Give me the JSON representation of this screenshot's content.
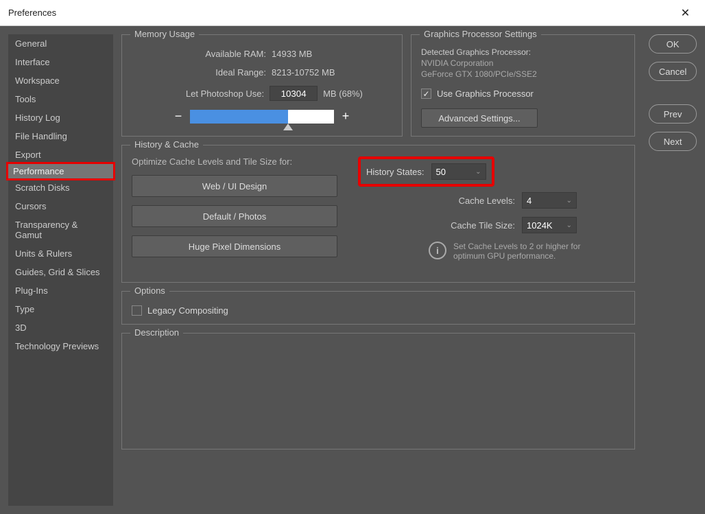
{
  "window": {
    "title": "Preferences"
  },
  "sidebar": {
    "items": [
      {
        "label": "General"
      },
      {
        "label": "Interface"
      },
      {
        "label": "Workspace"
      },
      {
        "label": "Tools"
      },
      {
        "label": "History Log"
      },
      {
        "label": "File Handling"
      },
      {
        "label": "Export"
      },
      {
        "label": "Performance",
        "selected": true
      },
      {
        "label": "Scratch Disks"
      },
      {
        "label": "Cursors"
      },
      {
        "label": "Transparency & Gamut"
      },
      {
        "label": "Units & Rulers"
      },
      {
        "label": "Guides, Grid & Slices"
      },
      {
        "label": "Plug-Ins"
      },
      {
        "label": "Type"
      },
      {
        "label": "3D"
      },
      {
        "label": "Technology Previews"
      }
    ]
  },
  "memory": {
    "title": "Memory Usage",
    "available_label": "Available RAM:",
    "available_value": "14933 MB",
    "ideal_label": "Ideal Range:",
    "ideal_value": "8213-10752 MB",
    "use_label": "Let Photoshop Use:",
    "use_value": "10304",
    "use_suffix": "MB (68%)"
  },
  "gpu": {
    "title": "Graphics Processor Settings",
    "detected_label": "Detected Graphics Processor:",
    "vendor": "NVIDIA Corporation",
    "device": "GeForce GTX 1080/PCIe/SSE2",
    "use_label": "Use Graphics Processor",
    "advanced": "Advanced Settings..."
  },
  "history": {
    "title": "History & Cache",
    "optimize_label": "Optimize Cache Levels and Tile Size for:",
    "presets": [
      "Web / UI Design",
      "Default / Photos",
      "Huge Pixel Dimensions"
    ],
    "history_states_label": "History States:",
    "history_states_value": "50",
    "cache_levels_label": "Cache Levels:",
    "cache_levels_value": "4",
    "cache_tile_label": "Cache Tile Size:",
    "cache_tile_value": "1024K",
    "info": "Set Cache Levels to 2 or higher for optimum GPU performance."
  },
  "options": {
    "title": "Options",
    "legacy": "Legacy Compositing"
  },
  "description": {
    "title": "Description"
  },
  "buttons": {
    "ok": "OK",
    "cancel": "Cancel",
    "prev": "Prev",
    "next": "Next"
  }
}
